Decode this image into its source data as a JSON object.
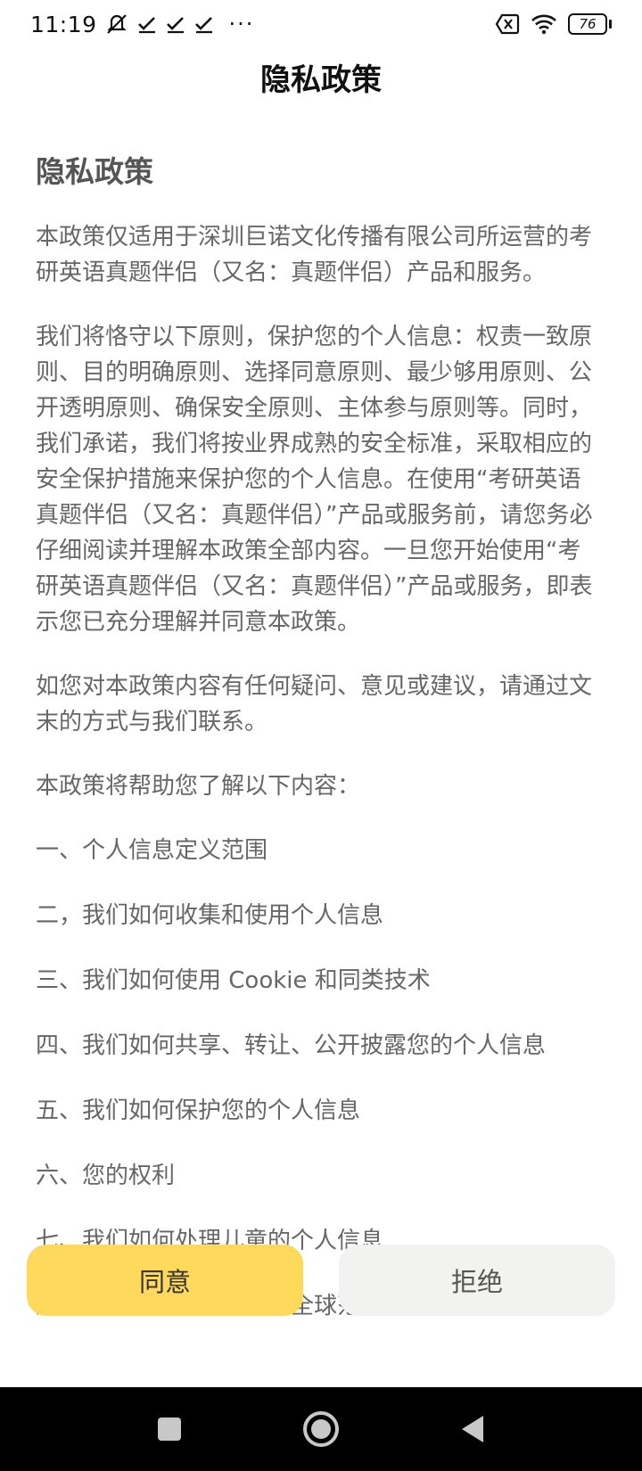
{
  "status_bar": {
    "time": "11:19",
    "battery": "76",
    "icons": [
      "mute-icon",
      "check-icon",
      "check-icon",
      "check-icon",
      "more-icon",
      "sim-off-icon",
      "wifi-icon",
      "battery-icon"
    ]
  },
  "nav": {
    "title": "隐私政策"
  },
  "document": {
    "heading": "隐私政策",
    "paragraphs": [
      "本政策仅适用于深圳巨诺文化传播有限公司所运营的考研英语真题伴侣（又名：真题伴侣）产品和服务。",
      "我们将恪守以下原则，保护您的个人信息：权责一致原则、目的明确原则、选择同意原则、最少够用原则、公开透明原则、确保安全原则、主体参与原则等。同时，我们承诺，我们将按业界成熟的安全标准，采取相应的安全保护措施来保护您的个人信息。在使用“考研英语真题伴侣（又名：真题伴侣）”产品或服务前，请您务必仔细阅读并理解本政策全部内容。一旦您开始使用“考研英语真题伴侣（又名：真题伴侣）”产品或服务，即表示您已充分理解并同意本政策。",
      "如您对本政策内容有任何疑问、意见或建议，请通过文末的方式与我们联系。",
      "本政策将帮助您了解以下内容："
    ],
    "toc": [
      "一、个人信息定义范围",
      "二，我们如何收集和使用个人信息",
      "三、我们如何使用 Cookie 和同类技术",
      "四、我们如何共享、转让、公开披露您的个人信息",
      "五、我们如何保护您的个人信息",
      "六、您的权利",
      "七、我们如何处理儿童的个人信息",
      "八、您的个人信息如何在全球范围转移"
    ]
  },
  "buttons": {
    "agree": "同意",
    "reject": "拒绝"
  },
  "colors": {
    "agree_bg": "#ffd95c",
    "reject_bg": "#f2f2f0",
    "text_gray": "#666666"
  }
}
